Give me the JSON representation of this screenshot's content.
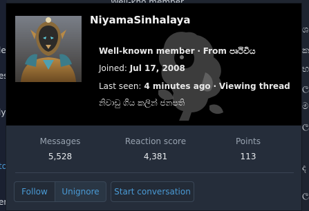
{
  "background": {
    "top_fragment": "Well-kno     member",
    "left_fragments": [
      "le",
      "es",
      "ly"
    ],
    "left_link": "to",
    "left_bottom": "ere",
    "right_fragments": [
      "ශ",
      "ක",
      "භ",
      "ල",
      "ම",
      "ල",
      "ද",
      "ල"
    ]
  },
  "profile": {
    "username": "NiyamaSinhalaya",
    "title": "Well-known member",
    "location": "From පෘථිවිය",
    "joined_label": "Joined:",
    "joined_value": "Jul 17, 2008",
    "last_seen_label": "Last seen:",
    "last_seen_value": "4 minutes ago",
    "activity": "Viewing thread",
    "custom_title": "නිවාඩු ගිය කලින් ජනපති",
    "separator": "·"
  },
  "stats": [
    {
      "label": "Messages",
      "value": "5,528"
    },
    {
      "label": "Reaction score",
      "value": "4,381"
    },
    {
      "label": "Points",
      "value": "113"
    }
  ],
  "buttons": {
    "follow": "Follow",
    "unignore": "Unignore",
    "start_conversation": "Start conversation"
  },
  "colors": {
    "link": "#4a9ad4",
    "header_bg": "#000000",
    "panel_bg": "#252d3a"
  },
  "icons": {
    "avatar": "armored-warrior-avatar",
    "watermark": "lion-emblem-watermark"
  }
}
